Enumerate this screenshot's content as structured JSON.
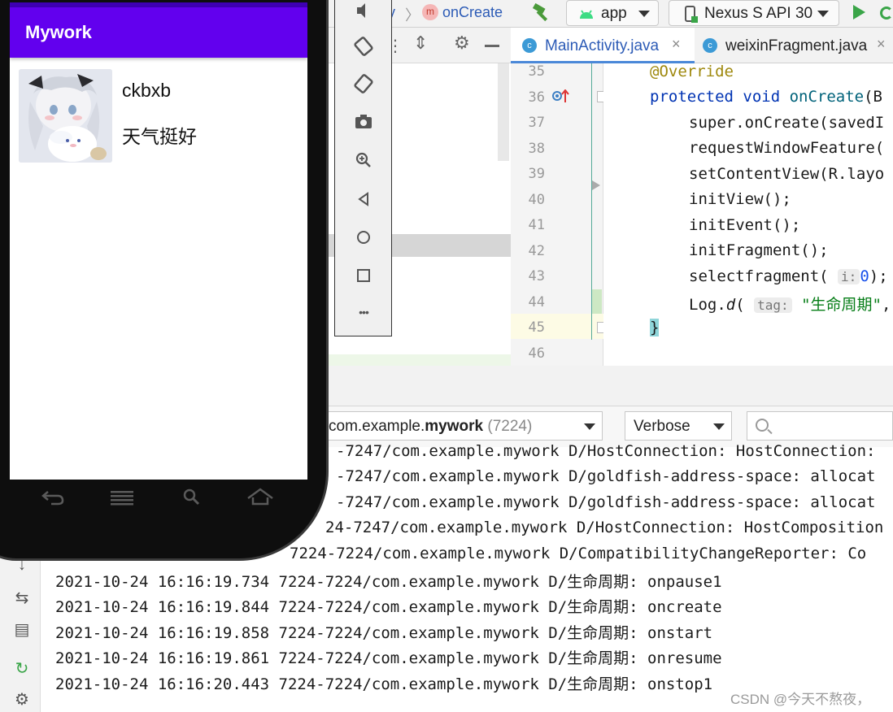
{
  "ide": {
    "breadcrumb": {
      "partial_class": "ty",
      "separator": "〉",
      "method_icon": "m",
      "method": "onCreate"
    },
    "run_config": {
      "label": "app"
    },
    "device": {
      "label": "Nexus S API 30"
    },
    "tabs": [
      {
        "icon": "c",
        "label": "MainActivity.java",
        "close": "×"
      },
      {
        "icon": "c",
        "label": "weixinFragment.java",
        "close": "×"
      }
    ],
    "line_numbers": [
      "35",
      "36",
      "37",
      "38",
      "39",
      "40",
      "41",
      "42",
      "43",
      "44",
      "45",
      "46"
    ],
    "code": {
      "l35": "@Override",
      "l36_kw": "protected void ",
      "l36_fn": "onCreate",
      "l36_rest": "(B",
      "l37": "super.onCreate(savedI",
      "l38": "requestWindowFeature(",
      "l39": "setContentView(R.layo",
      "l40": "initView();",
      "l41": "initEvent();",
      "l42": "initFragment();",
      "l43_pre": "selectfragment(",
      "l43_hint": "i:",
      "l43_num": "0",
      "l43_post": ");",
      "l44_pre": "Log.",
      "l44_fn": "d",
      "l44_paren": "(",
      "l44_hint": "tag:",
      "l44_str": "\"生命周期\"",
      "l44_post": ",",
      "l45": "}"
    },
    "logcat": {
      "process_prefix": "com.example.",
      "process_bold": "mywork",
      "process_pid": "(7224)",
      "level": "Verbose",
      "search_placeholder": ""
    },
    "log_lines": [
      "-7247/com.example.mywork D/HostConnection: HostConnection:",
      "-7247/com.example.mywork D/goldfish-address-space: allocat",
      "-7247/com.example.mywork D/goldfish-address-space: allocat",
      "24-7247/com.example.mywork D/HostConnection: HostComposition",
      "7224-7224/com.example.mywork D/CompatibilityChangeReporter: Co",
      "2021-10-24 16:16:19.734 7224-7224/com.example.mywork D/生命周期: onpause1",
      "2021-10-24 16:16:19.844 7224-7224/com.example.mywork D/生命周期: oncreate",
      "2021-10-24 16:16:19.858 7224-7224/com.example.mywork D/生命周期: onstart",
      "2021-10-24 16:16:19.861 7224-7224/com.example.mywork D/生命周期: onresume",
      "2021-10-24 16:16:20.443 7224-7224/com.example.mywork D/生命周期: onstop1"
    ],
    "watermark": "CSDN @今天不熬夜，"
  },
  "emulator": {
    "app_title": "Mywork",
    "item": {
      "name": "ckbxb",
      "message": "天气挺好"
    },
    "more_label": "•••"
  },
  "colors": {
    "app_bar": "#6200ee",
    "status_bar": "#3e00b3",
    "accent_run": "#3aa548",
    "link": "#2c5bb6"
  }
}
